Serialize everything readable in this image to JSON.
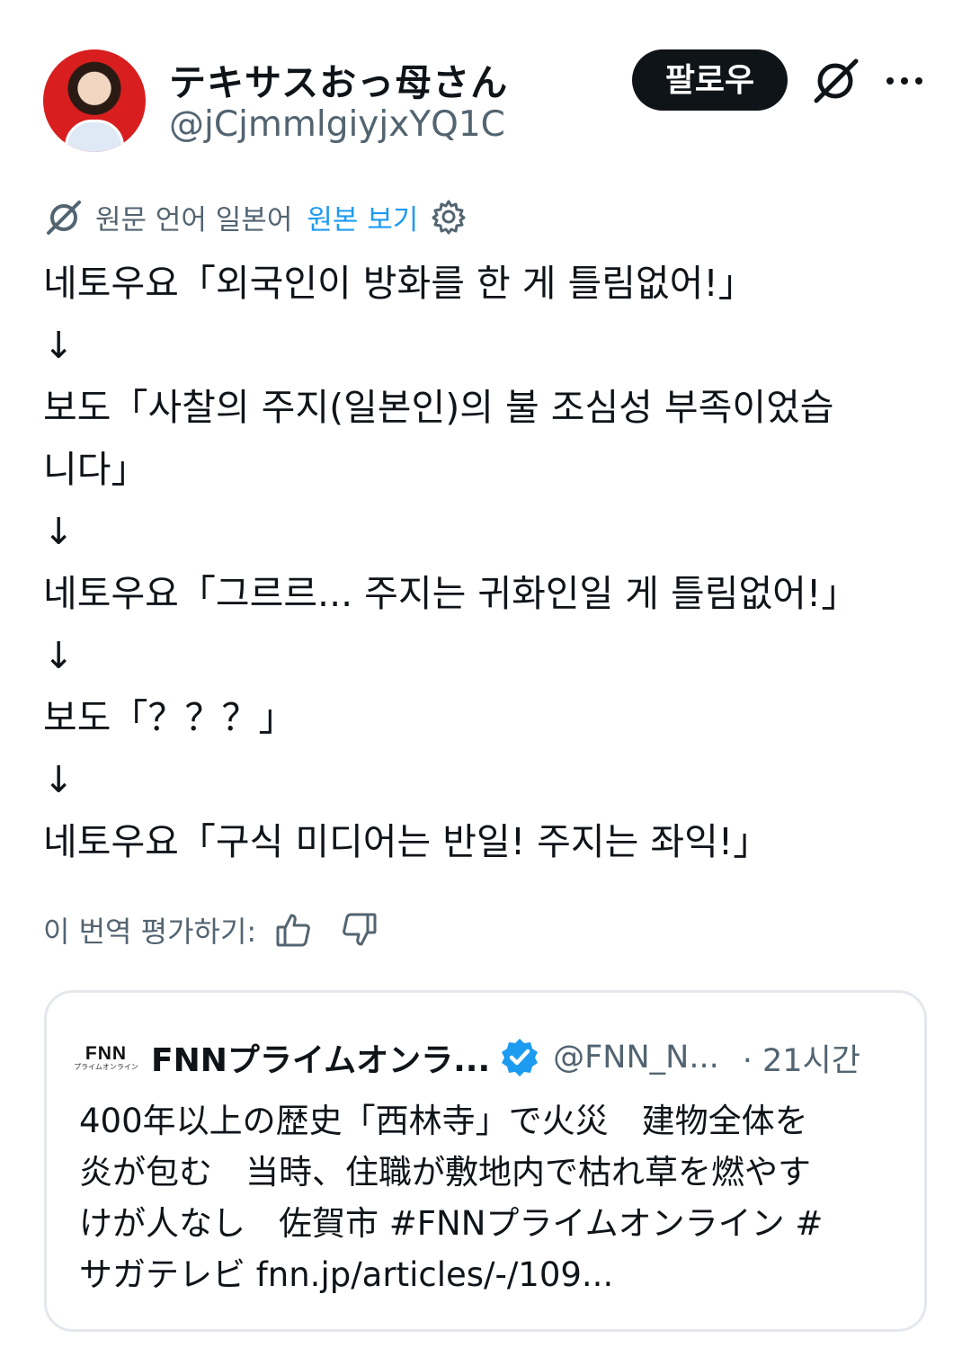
{
  "author": {
    "display_name": "テキサスおっ母さん",
    "handle": "@jCjmmlgiyjxYQ1C",
    "avatar_icon": "profile-photo"
  },
  "actions": {
    "follow_label": "팔로우",
    "grok_icon": "grok-icon",
    "more_icon": "more-icon"
  },
  "translation": {
    "source_language_label": "원문 언어 일본어",
    "show_original_label": "원본 보기",
    "rate_label": "이 번역 평가하기:"
  },
  "tweet": {
    "lines": [
      "네토우요「외국인이 방화를 한 게 틀림없어!」",
      "↓",
      "보도「사찰의 주지(일본인)의 불 조심성 부족이었습",
      "니다」",
      "↓",
      "네토우요「그르르... 주지는 귀화인일 게 틀림없어!」",
      "↓",
      "보도「？？？」",
      "↓",
      "네토우요「구식 미디어는 반일! 주지는 좌익!」"
    ]
  },
  "quoted_tweet": {
    "logo_text": "FNN",
    "logo_subtext": "プライムオンライン",
    "name": "FNNプライムオンラ...",
    "handle": "@FNN_N...",
    "time": "· 21시간",
    "text_lines": [
      "400年以上の歴史「西林寺」で火災　建物全体を",
      "炎が包む　当時、住職が敷地内で枯れ草を燃やす",
      "けが人なし　佐賀市 #FNNプライムオンライン #",
      "サガテレビ fnn.jp/articles/-/109..."
    ]
  },
  "colors": {
    "text": "#0f1419",
    "secondary": "#536471",
    "link": "#1d9bf0",
    "verified": "#1d9bf0",
    "follow_button_bg": "#0f1419",
    "border": "#e4e8ec"
  }
}
